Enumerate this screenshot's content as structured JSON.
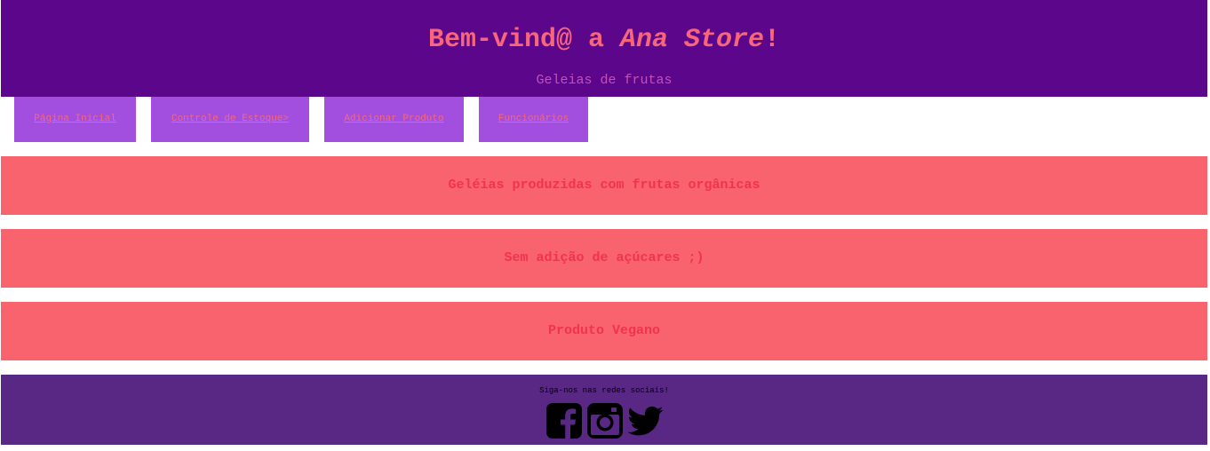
{
  "header": {
    "title_prefix": "Bem-vind@ a ",
    "title_brand": "Ana Store",
    "title_suffix": "!",
    "subtitle": "Geleias de frutas"
  },
  "nav": {
    "items": [
      {
        "label": "Página Inicial"
      },
      {
        "label": "Controle de Estoque>"
      },
      {
        "label": "Adicionar Produto"
      },
      {
        "label": "Funcionários"
      }
    ]
  },
  "features": [
    {
      "text": "Geléias produzidas com frutas orgânicas"
    },
    {
      "text": "Sem adição de açúcares ;)"
    },
    {
      "text": "Produto Vegano"
    }
  ],
  "footer": {
    "follow_text": "Siga-nos nas redes sociais!",
    "social": [
      {
        "icon": "facebook-icon"
      },
      {
        "icon": "instagram-icon"
      },
      {
        "icon": "twitter-icon"
      }
    ]
  },
  "colors": {
    "header_bg": "#5c068c",
    "title": "#f8667a",
    "subtitle": "#c351b7",
    "nav_bg": "#a24fe0",
    "banner_bg": "#f8636d",
    "banner_text": "#f1334f",
    "footer_bg": "#592784"
  }
}
